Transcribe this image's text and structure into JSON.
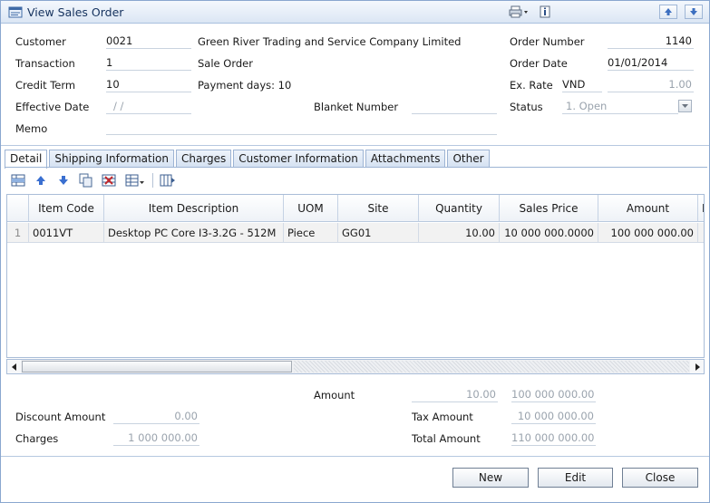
{
  "window": {
    "title": "View Sales Order"
  },
  "header": {
    "customer": {
      "label": "Customer",
      "code": "0021",
      "name": "Green River  Trading and Service Company Limited"
    },
    "transaction": {
      "label": "Transaction",
      "code": "1",
      "name": "Sale Order"
    },
    "credit_term": {
      "label": "Credit Term",
      "code": "10",
      "info": "Payment days: 10"
    },
    "effective_date": {
      "label": "Effective Date",
      "value": "/ /"
    },
    "blanket_number": {
      "label": "Blanket Number",
      "value": ""
    },
    "memo": {
      "label": "Memo",
      "value": ""
    },
    "order_number": {
      "label": "Order Number",
      "value": "1140"
    },
    "order_date": {
      "label": "Order Date",
      "value": "01/01/2014"
    },
    "ex_rate": {
      "label": "Ex. Rate",
      "currency": "VND",
      "value": "1.00"
    },
    "status": {
      "label": "Status",
      "value": "1. Open"
    }
  },
  "tabs": [
    {
      "label": "Detail",
      "active": true
    },
    {
      "label": "Shipping Information",
      "active": false
    },
    {
      "label": "Charges",
      "active": false
    },
    {
      "label": "Customer Information",
      "active": false
    },
    {
      "label": "Attachments",
      "active": false
    },
    {
      "label": "Other",
      "active": false
    }
  ],
  "grid": {
    "columns": [
      "Item Code",
      "Item Description",
      "UOM",
      "Site",
      "Quantity",
      "Sales Price",
      "Amount",
      "I"
    ],
    "rows": [
      {
        "num": "1",
        "item_code": "0011VT",
        "description": "Desktop PC Core I3-3.2G - 512M",
        "uom": "Piece",
        "site": "GG01",
        "quantity": "10.00",
        "sales_price": "10 000 000.0000",
        "amount": "100 000 000.00"
      }
    ]
  },
  "totals": {
    "amount_label": "Amount",
    "amount_qty": "10.00",
    "amount_value": "100 000 000.00",
    "discount_label": "Discount Amount",
    "discount_value": "0.00",
    "tax_label": "Tax Amount",
    "tax_value": "10 000 000.00",
    "charges_label": "Charges",
    "charges_value": "1 000 000.00",
    "total_label": "Total Amount",
    "total_value": "110 000 000.00"
  },
  "buttons": {
    "new": "New",
    "edit": "Edit",
    "close": "Close"
  }
}
